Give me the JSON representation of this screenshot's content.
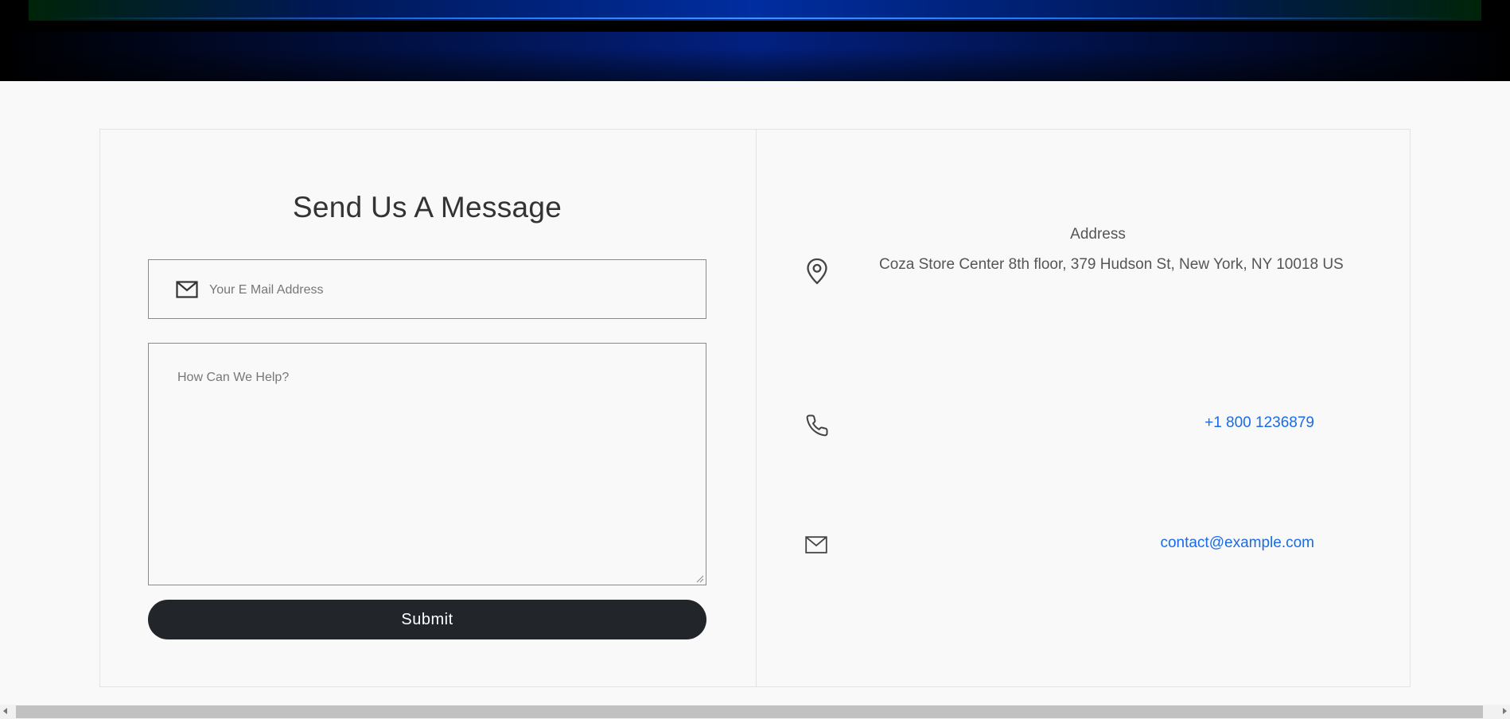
{
  "contact_form": {
    "title": "Send Us A Message",
    "email_placeholder": "Your E Mail Address",
    "message_placeholder": "How Can We Help?",
    "submit_label": "Submit"
  },
  "contact_info": {
    "address_heading": "Address",
    "address_text": "Coza Store Center 8th floor, 379 Hudson St, New York, NY 10018 US",
    "phone": "+1 800 1236879",
    "email": "contact@example.com"
  },
  "icons": {
    "email_field": "mail-icon",
    "address": "map-pin-icon",
    "phone": "phone-icon",
    "email": "mail-icon"
  },
  "colors": {
    "accent_link": "#1a6be8",
    "button_bg": "#222529",
    "page_bg": "#f9f9f9"
  }
}
